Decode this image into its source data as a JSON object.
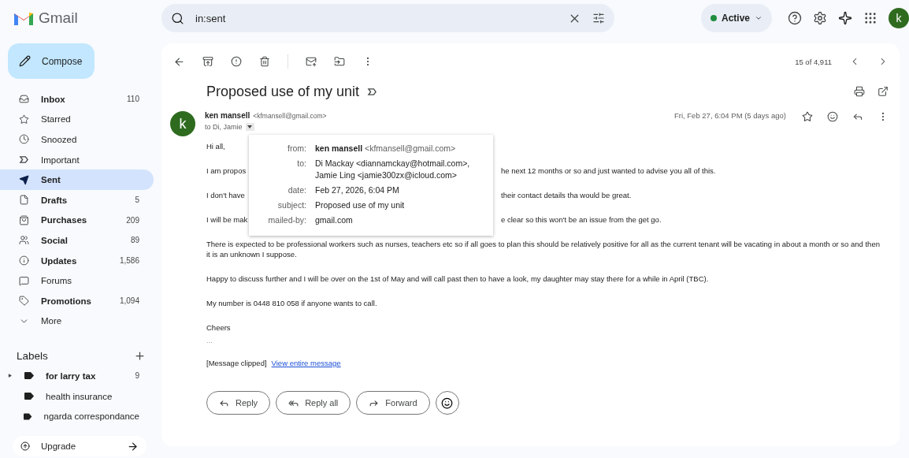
{
  "app": {
    "name": "Gmail"
  },
  "compose": {
    "label": "Compose"
  },
  "sidebar": {
    "items": [
      {
        "label": "Inbox",
        "count": "110",
        "unread": true,
        "selected": false
      },
      {
        "label": "Starred",
        "unread": false,
        "selected": false
      },
      {
        "label": "Snoozed",
        "unread": false,
        "selected": false
      },
      {
        "label": "Important",
        "unread": false,
        "selected": false
      },
      {
        "label": "Sent",
        "unread": true,
        "selected": true
      },
      {
        "label": "Drafts",
        "count": "5",
        "unread": true,
        "selected": false
      },
      {
        "label": "Purchases",
        "count": "209",
        "unread": true,
        "selected": false
      },
      {
        "label": "Social",
        "count": "89",
        "unread": true,
        "selected": false
      },
      {
        "label": "Updates",
        "count": "1,586",
        "unread": true,
        "selected": false
      },
      {
        "label": "Forums",
        "unread": false,
        "selected": false
      },
      {
        "label": "Promotions",
        "count": "1,094",
        "unread": true,
        "selected": false
      },
      {
        "label": "More",
        "unread": false,
        "selected": false
      }
    ],
    "labels_title": "Labels",
    "labels": [
      {
        "label": "for larry tax",
        "count": "9",
        "unread": true,
        "has_children": true
      },
      {
        "label": "health insurance",
        "unread": false,
        "has_children": false
      },
      {
        "label": "ngarda correspondance",
        "unread": false,
        "has_children": false
      }
    ],
    "upgrade": "Upgrade"
  },
  "search": {
    "value": "in:sent"
  },
  "status": {
    "label": "Active",
    "color": "#1e8e3e"
  },
  "account": {
    "initial": "k"
  },
  "toolbar": {
    "position": "15 of 4,911"
  },
  "message": {
    "subject": "Proposed use of my unit",
    "sender_name": "ken mansell",
    "sender_email": "<kfmansell@gmail.com>",
    "avatar": "k",
    "to": "to Di, Jamie",
    "date": "Fri, Feb 27, 6:04 PM (5 days ago)",
    "greeting": "Hi all,",
    "covered_paragraphs": [
      {
        "left": "I am propos",
        "right": "he next 12 months or so and just wanted to advise you all of this."
      },
      {
        "left": "I don't have",
        "right": "their contact details tha would be great."
      },
      {
        "left": "I will be mak",
        "right": "e clear so this won't be an issue from the get go."
      }
    ],
    "paragraphs": [
      "There is expected to be professional workers such as nurses, teachers etc so if all goes to plan this should be relatively positive for all as the current tenant will be vacating in about a month or so and then it is an unknown I suppose.",
      "Happy to discuss further and I will be over on the 1st of May and will call past then to have a look, my daughter may stay there for a while in April (TBC).",
      "My number is 0448 810 058 if anyone wants to call.",
      "Cheers"
    ],
    "ellipsis": "...",
    "clipped": "[Message clipped]",
    "view_link": "View entire message",
    "actions": [
      "Reply",
      "Reply all",
      "Forward"
    ]
  },
  "details": {
    "rows": [
      {
        "key": "from:",
        "name": "ken mansell",
        "value": "<kfmansell@gmail.com>"
      },
      {
        "key": "to:",
        "lines": [
          "Di Mackay <diannamckay@hotmail.com>,",
          "Jamie Ling <jamie300zx@icloud.com>"
        ]
      },
      {
        "key": "date:",
        "value": "Feb 27, 2026, 6:04 PM"
      },
      {
        "key": "subject:",
        "value": "Proposed use of my unit"
      },
      {
        "key": "mailed-by:",
        "value": "gmail.com"
      }
    ]
  }
}
